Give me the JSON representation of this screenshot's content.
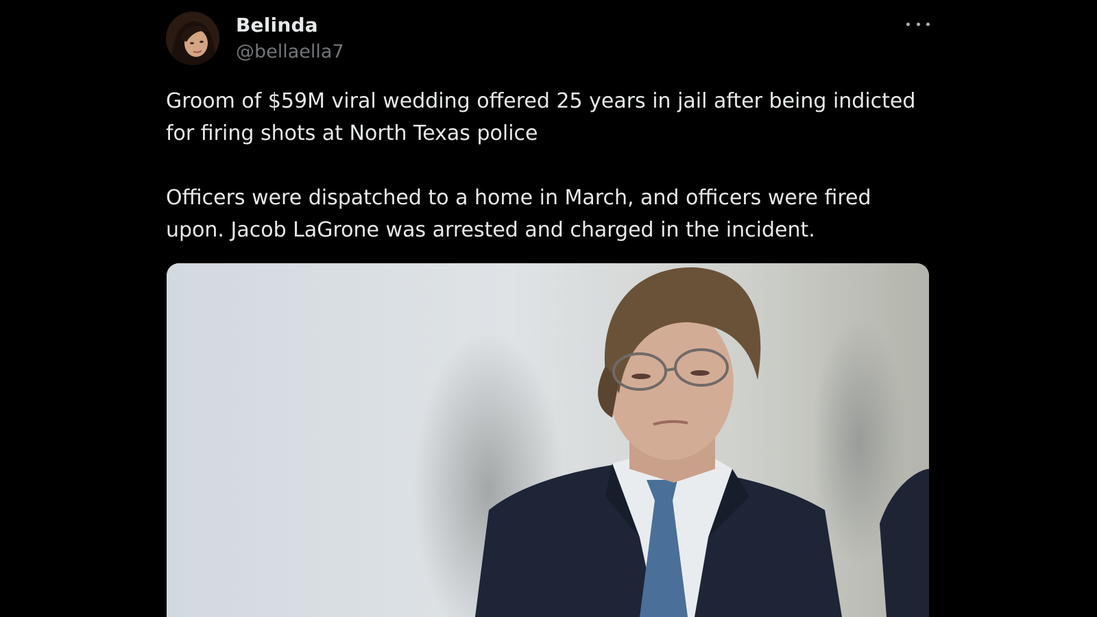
{
  "author": {
    "display_name": "Belinda",
    "handle": "@bellaella7"
  },
  "tweet": {
    "paragraphs": [
      "Groom of $59M viral wedding offered 25 years in jail after being indicted for firing shots at North Texas police",
      "Officers were dispatched to a home in March, and officers were fired upon. Jacob LaGrone was arrested and charged in the incident."
    ]
  },
  "icons": {
    "more": "more-horizontal-icon"
  },
  "colors": {
    "background": "#000000",
    "text_primary": "#e7e9ea",
    "text_secondary": "#71767b"
  }
}
